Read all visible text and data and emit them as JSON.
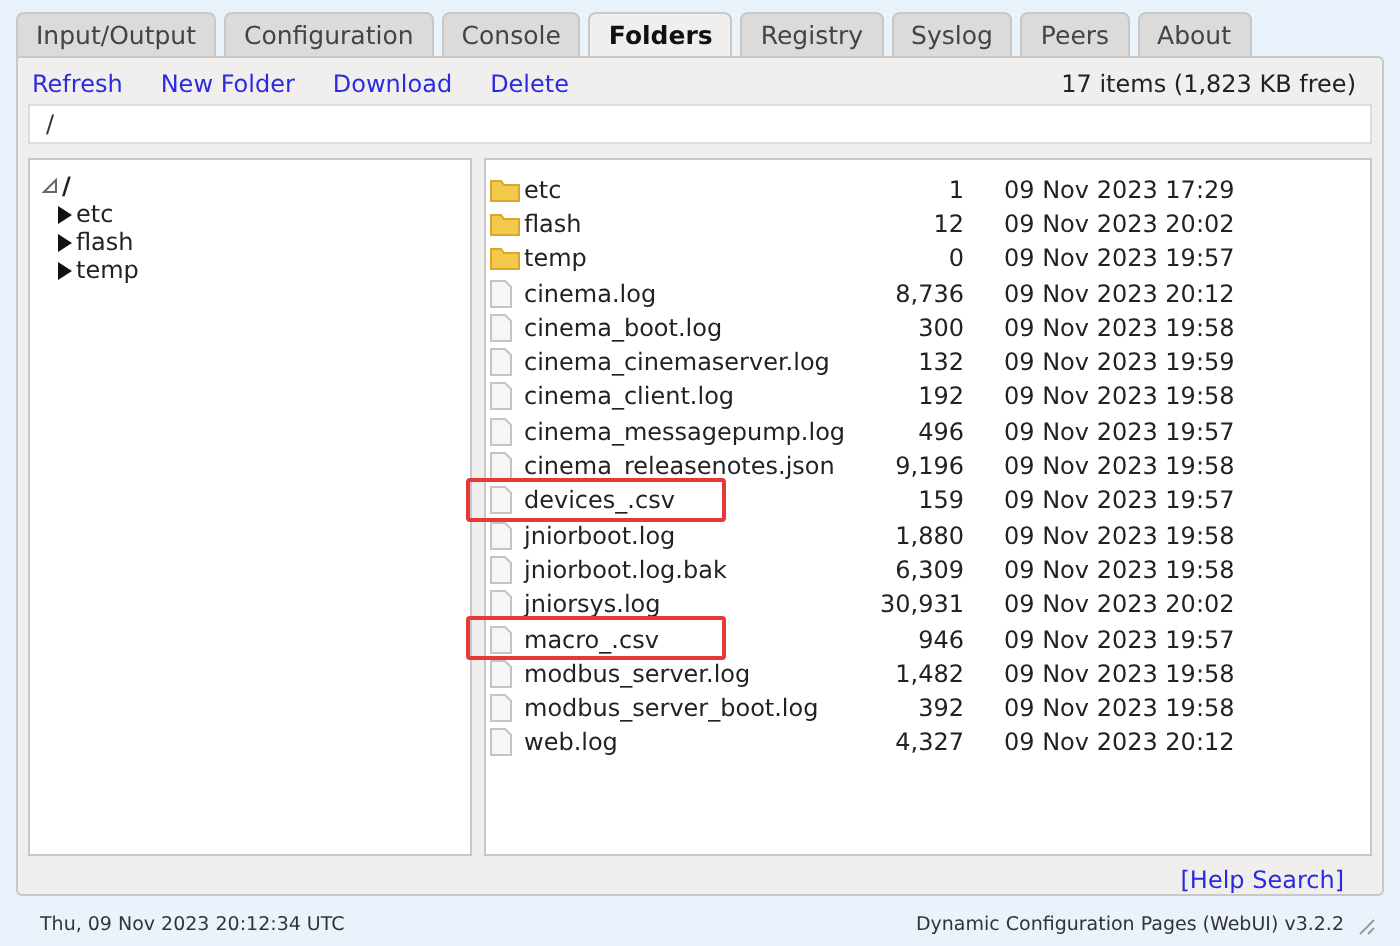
{
  "tabs": [
    {
      "label": "Input/Output",
      "selected": false
    },
    {
      "label": "Configuration",
      "selected": false
    },
    {
      "label": "Console",
      "selected": false
    },
    {
      "label": "Folders",
      "selected": true
    },
    {
      "label": "Registry",
      "selected": false
    },
    {
      "label": "Syslog",
      "selected": false
    },
    {
      "label": "Peers",
      "selected": false
    },
    {
      "label": "About",
      "selected": false
    }
  ],
  "toolbar": {
    "links": [
      "Refresh",
      "New Folder",
      "Download",
      "Delete"
    ],
    "summary": "17 items (1,823 KB free)"
  },
  "path": {
    "value": "/"
  },
  "tree": {
    "label": "/",
    "expanded": true,
    "children": [
      {
        "label": "etc",
        "expanded": false
      },
      {
        "label": "flash",
        "expanded": false
      },
      {
        "label": "temp",
        "expanded": false
      }
    ]
  },
  "files": [
    {
      "kind": "folder",
      "name": "etc",
      "size": "1",
      "modified": "09 Nov 2023 17:29",
      "highlighted": false
    },
    {
      "kind": "folder",
      "name": "flash",
      "size": "12",
      "modified": "09 Nov 2023 20:02",
      "highlighted": false
    },
    {
      "kind": "folder",
      "name": "temp",
      "size": "0",
      "modified": "09 Nov 2023 19:57",
      "highlighted": false
    },
    {
      "kind": "file",
      "name": "cinema.log",
      "size": "8,736",
      "modified": "09 Nov 2023 20:12",
      "highlighted": false
    },
    {
      "kind": "file",
      "name": "cinema_boot.log",
      "size": "300",
      "modified": "09 Nov 2023 19:58",
      "highlighted": false
    },
    {
      "kind": "file",
      "name": "cinema_cinemaserver.log",
      "size": "132",
      "modified": "09 Nov 2023 19:59",
      "highlighted": false
    },
    {
      "kind": "file",
      "name": "cinema_client.log",
      "size": "192",
      "modified": "09 Nov 2023 19:58",
      "highlighted": false
    },
    {
      "kind": "file",
      "name": "cinema_messagepump.log",
      "size": "496",
      "modified": "09 Nov 2023 19:57",
      "highlighted": false
    },
    {
      "kind": "file",
      "name": "cinema_releasenotes.json",
      "size": "9,196",
      "modified": "09 Nov 2023 19:58",
      "highlighted": false
    },
    {
      "kind": "file",
      "name": "devices_.csv",
      "size": "159",
      "modified": "09 Nov 2023 19:57",
      "highlighted": true
    },
    {
      "kind": "file",
      "name": "jniorboot.log",
      "size": "1,880",
      "modified": "09 Nov 2023 19:58",
      "highlighted": false
    },
    {
      "kind": "file",
      "name": "jniorboot.log.bak",
      "size": "6,309",
      "modified": "09 Nov 2023 19:58",
      "highlighted": false
    },
    {
      "kind": "file",
      "name": "jniorsys.log",
      "size": "30,931",
      "modified": "09 Nov 2023 20:02",
      "highlighted": false
    },
    {
      "kind": "file",
      "name": "macro_.csv",
      "size": "946",
      "modified": "09 Nov 2023 19:57",
      "highlighted": true
    },
    {
      "kind": "file",
      "name": "modbus_server.log",
      "size": "1,482",
      "modified": "09 Nov 2023 19:58",
      "highlighted": false
    },
    {
      "kind": "file",
      "name": "modbus_server_boot.log",
      "size": "392",
      "modified": "09 Nov 2023 19:58",
      "highlighted": false
    },
    {
      "kind": "file",
      "name": "web.log",
      "size": "4,327",
      "modified": "09 Nov 2023 20:12",
      "highlighted": false
    }
  ],
  "help_link": "[Help Search]",
  "status_bar": {
    "timestamp": "Thu, 09 Nov 2023 20:12:34 UTC",
    "version": "Dynamic Configuration Pages (WebUI) v3.2.2"
  }
}
